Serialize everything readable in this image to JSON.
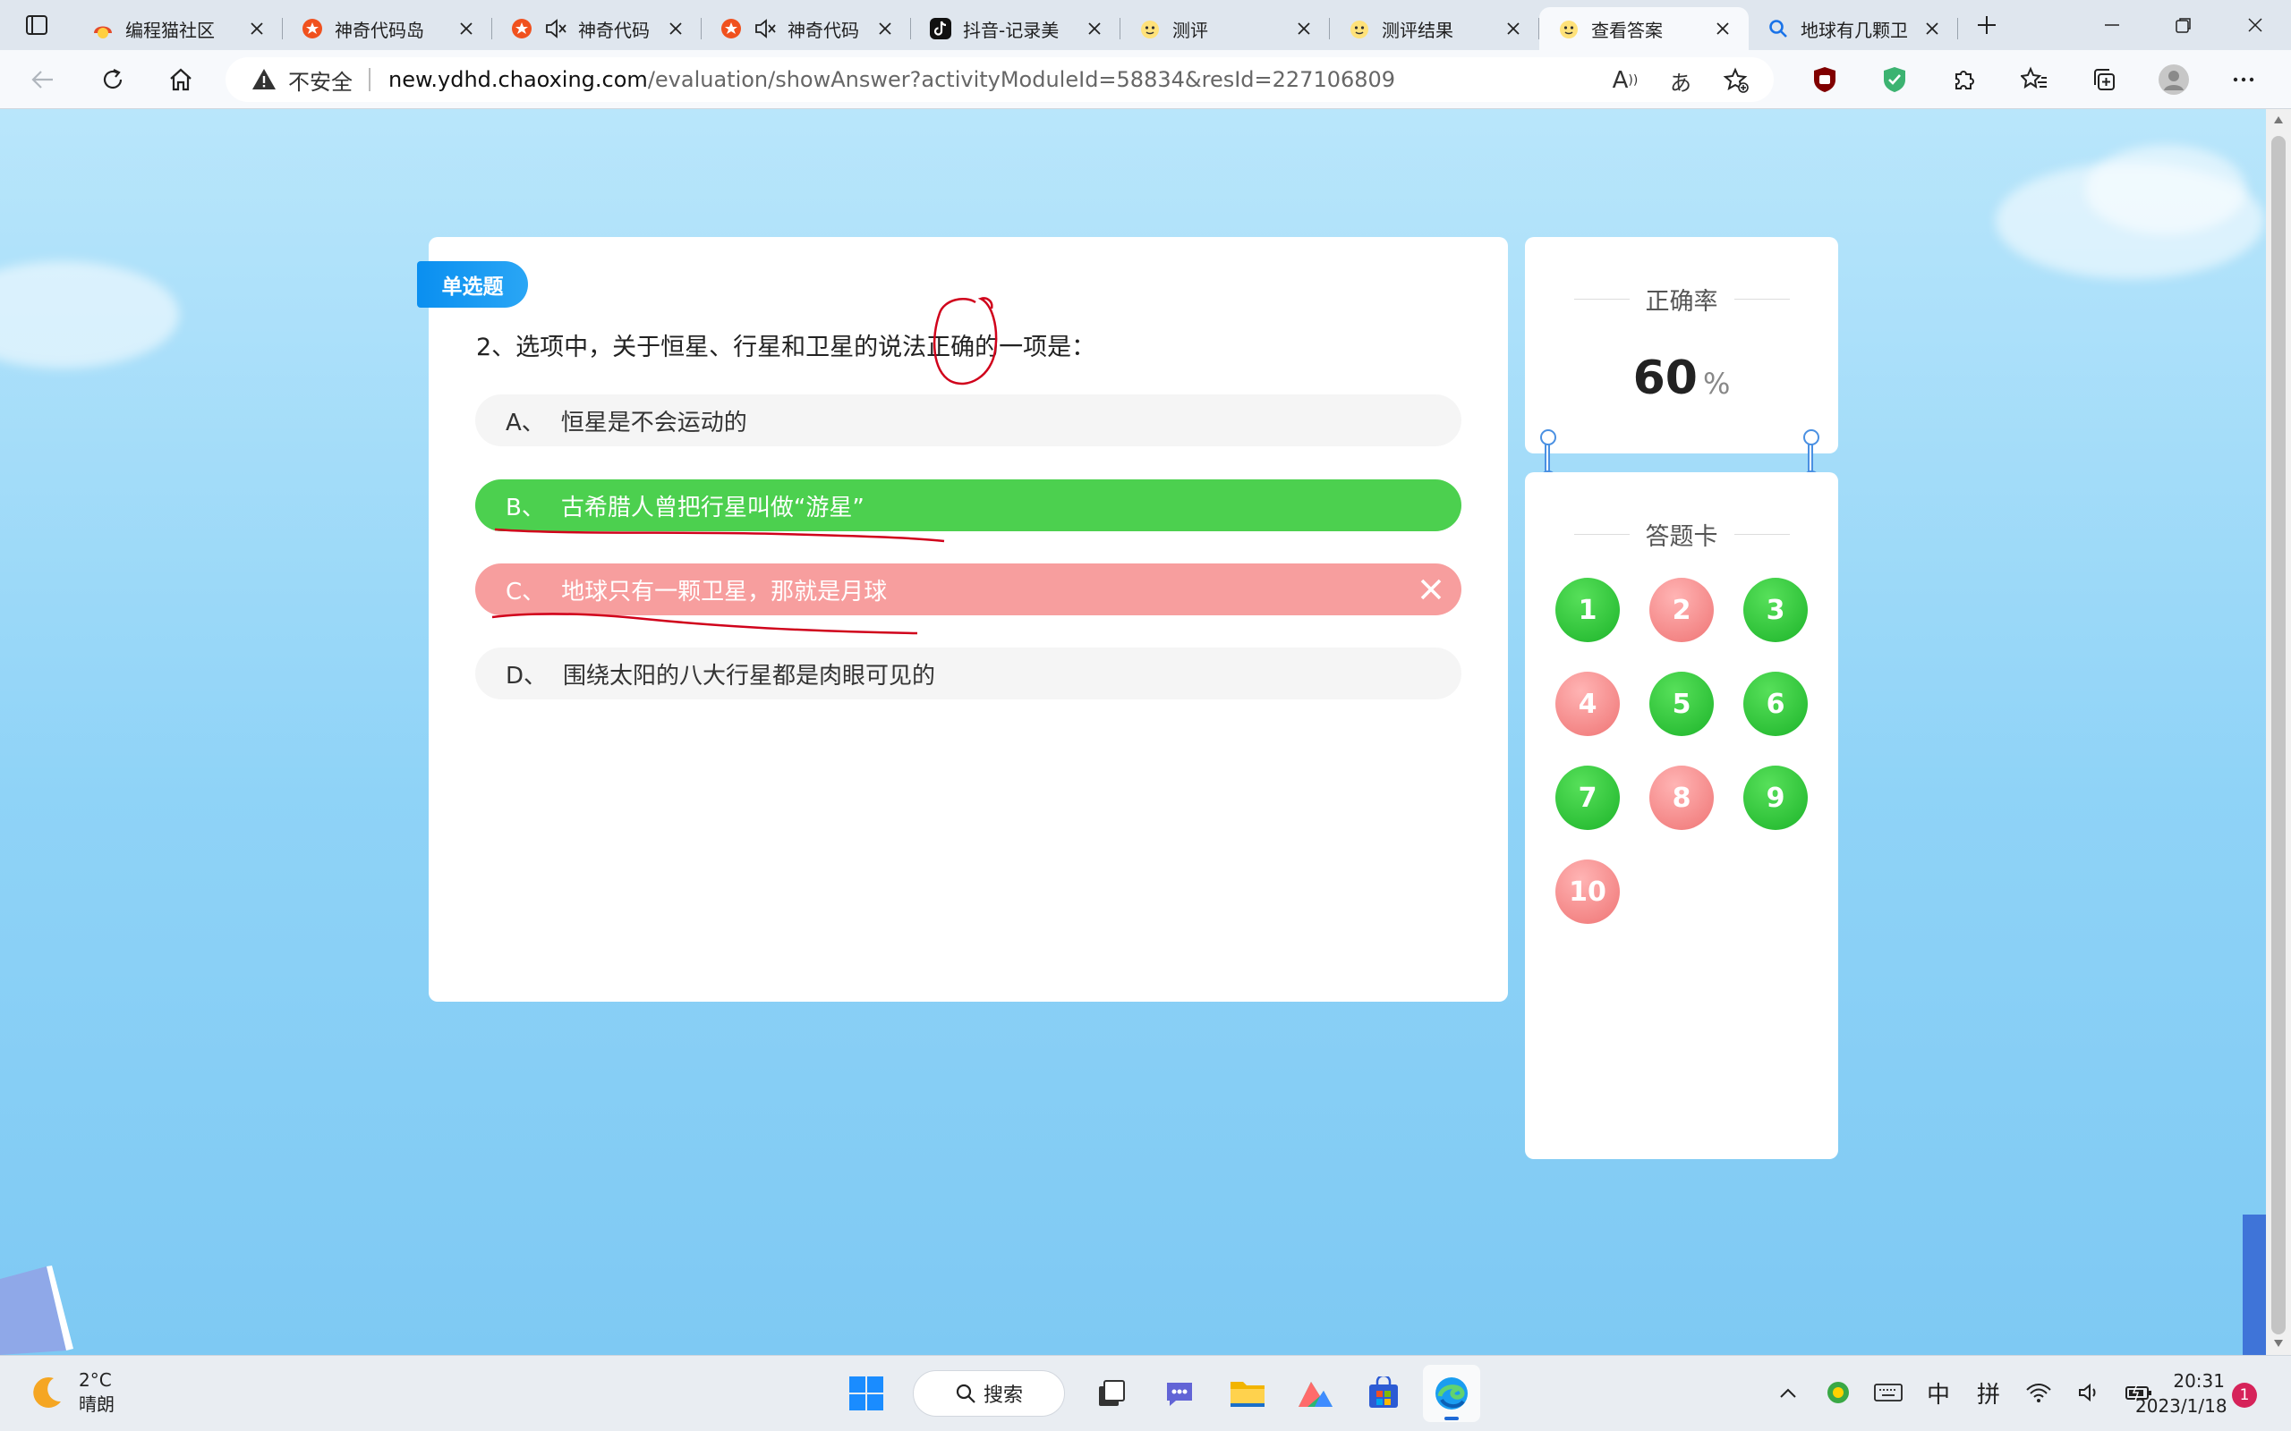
{
  "tabs": [
    {
      "title": "编程猫社区",
      "favicon": "codemao-icon",
      "muted": false,
      "active": false
    },
    {
      "title": "神奇代码岛",
      "favicon": "codeisland-icon",
      "muted": false,
      "active": false
    },
    {
      "title": "神奇代码",
      "favicon": "codeisland-icon",
      "muted": true,
      "active": false
    },
    {
      "title": "神奇代码",
      "favicon": "codeisland-icon",
      "muted": true,
      "active": false
    },
    {
      "title": "抖音-记录美",
      "favicon": "douyin-icon",
      "muted": false,
      "active": false
    },
    {
      "title": "测评",
      "favicon": "chaoxing-icon",
      "muted": false,
      "active": false
    },
    {
      "title": "测评结果",
      "favicon": "chaoxing-icon",
      "muted": false,
      "active": false
    },
    {
      "title": "查看答案",
      "favicon": "chaoxing-icon",
      "muted": false,
      "active": true
    },
    {
      "title": "地球有几颗卫",
      "favicon": "search-icon",
      "muted": false,
      "active": false
    }
  ],
  "address": {
    "security_label": "不安全",
    "host": "new.ydhd.chaoxing.com",
    "path": "/evaluation/showAnswer?activityModuleId=58834&resId=227106809"
  },
  "omni_icons": {
    "read_aloud": "A",
    "translate": "あ"
  },
  "question": {
    "type_badge": "单选题",
    "text": "2、选项中，关于恒星、行星和卫星的说法正确的一项是：",
    "options": [
      {
        "letter": "A、",
        "text": "恒星是不会运动的",
        "state": "neutral"
      },
      {
        "letter": "B、",
        "text": "古希腊人曾把行星叫做“游星”",
        "state": "correct"
      },
      {
        "letter": "C、",
        "text": "地球只有一颗卫星，那就是月球",
        "state": "wrong"
      },
      {
        "letter": "D、",
        "text": "围绕太阳的八大行星都是肉眼可见的",
        "state": "neutral"
      }
    ]
  },
  "stats": {
    "title": "正确率",
    "accuracy": "60",
    "unit": "%"
  },
  "answer_sheet": {
    "title": "答题卡",
    "items": [
      {
        "label": "1",
        "status": "right"
      },
      {
        "label": "2",
        "status": "miss"
      },
      {
        "label": "3",
        "status": "right"
      },
      {
        "label": "4",
        "status": "miss"
      },
      {
        "label": "5",
        "status": "right"
      },
      {
        "label": "6",
        "status": "right"
      },
      {
        "label": "7",
        "status": "right"
      },
      {
        "label": "8",
        "status": "miss"
      },
      {
        "label": "9",
        "status": "right"
      },
      {
        "label": "10",
        "status": "miss"
      }
    ]
  },
  "colors": {
    "correct": "#4cd04f",
    "wrong": "#f79e9e",
    "badge": "#0a8ff0",
    "annotation": "#d0021b"
  },
  "taskbar": {
    "weather_temp": "2°C",
    "weather_desc": "晴朗",
    "search_label": "搜索",
    "ime_mode": "中",
    "ime_name": "拼",
    "time": "20:31",
    "date": "2023/1/18",
    "notification_count": "1"
  }
}
